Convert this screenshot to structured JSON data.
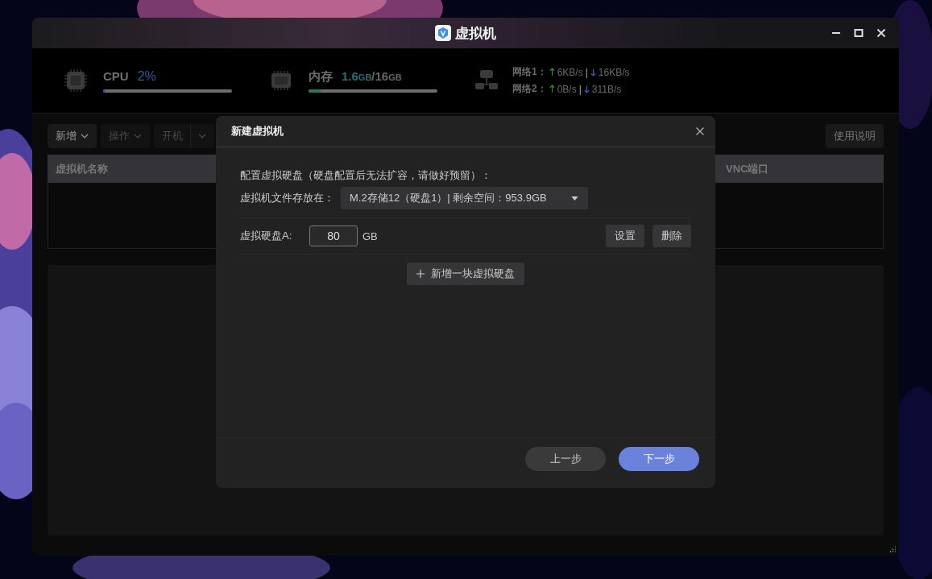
{
  "window": {
    "title": "虚拟机"
  },
  "stats": {
    "cpu": {
      "label": "CPU",
      "value": "2%",
      "level": 0.02
    },
    "memory": {
      "label": "内存",
      "used": "1.6",
      "used_unit": "GB",
      "slash": "/",
      "total": "16",
      "total_unit": "GB",
      "level": 0.1
    },
    "network": [
      {
        "label": "网络1：",
        "up": "6KB/s",
        "sep": "|",
        "down": "16KB/s"
      },
      {
        "label": "网络2：",
        "up": "0B/s",
        "sep": "|",
        "down": "311B/s"
      }
    ]
  },
  "toolbar": {
    "buttons": [
      {
        "label": "新增",
        "kind": "dropdown",
        "disabled": false
      },
      {
        "label": "操作",
        "kind": "dropdown",
        "disabled": true
      },
      {
        "label": "开机",
        "kind": "split",
        "disabled": true
      }
    ],
    "help": "使用说明"
  },
  "table": {
    "columns": [
      "虚拟机名称",
      "VNC端口"
    ]
  },
  "dialog": {
    "title": "新建虚拟机",
    "section_label": "配置虚拟硬盘（硬盘配置后无法扩容，请做好预留）：",
    "storage_label": "虚拟机文件存放在：",
    "storage_value": "M.2存储12（硬盘1）| 剩余空间：953.9GB",
    "disks": [
      {
        "label": "虚拟硬盘A:",
        "value": "80",
        "unit": "GB",
        "actions": [
          "设置",
          "删除"
        ]
      }
    ],
    "add_button": "新增一块虚拟硬盘",
    "footer_buttons": [
      {
        "label": "上一步",
        "kind": "secondary"
      },
      {
        "label": "下一步",
        "kind": "primary"
      }
    ]
  }
}
